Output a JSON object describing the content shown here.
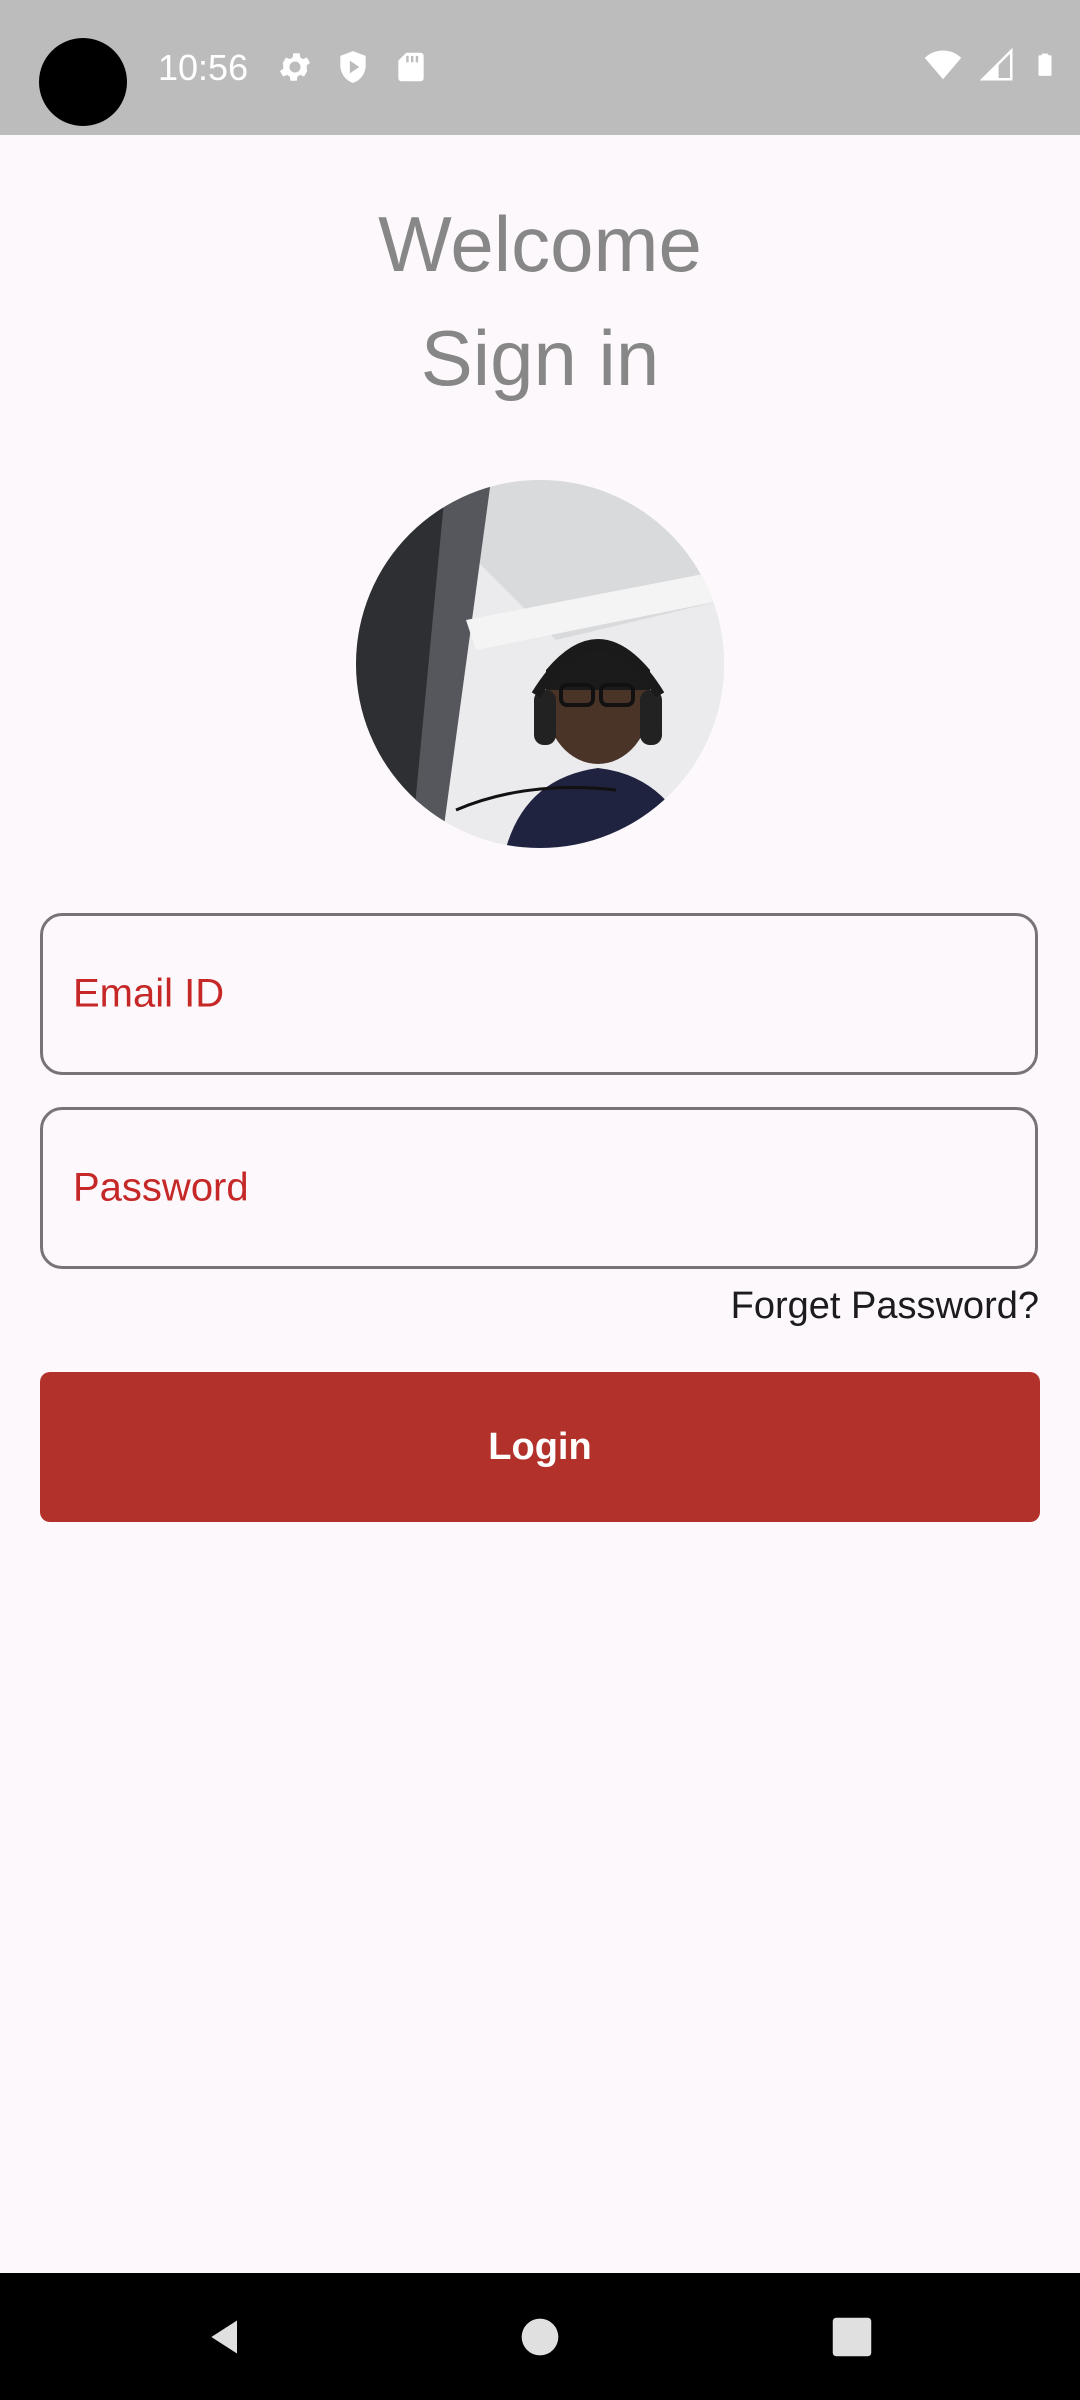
{
  "status_bar": {
    "time": "10:56",
    "left_icons": [
      "gear-icon",
      "shield-play-icon",
      "sd-card-icon"
    ],
    "right_icons": [
      "wifi-icon",
      "signal-icon",
      "battery-icon"
    ]
  },
  "header": {
    "welcome": "Welcome",
    "sign_in": "Sign in"
  },
  "avatar": {
    "description_icon": "profile-photo"
  },
  "form": {
    "email_label": "Email ID",
    "email_value": "",
    "password_label": "Password",
    "password_value": "",
    "forget_password": "Forget Password?",
    "login_label": "Login"
  },
  "nav_bar": {
    "icons": [
      "back-icon",
      "home-icon",
      "recents-icon"
    ]
  },
  "colors": {
    "accent": "#b3312b",
    "label": "#c62828",
    "background": "#fdf8fb",
    "heading": "#878787"
  }
}
